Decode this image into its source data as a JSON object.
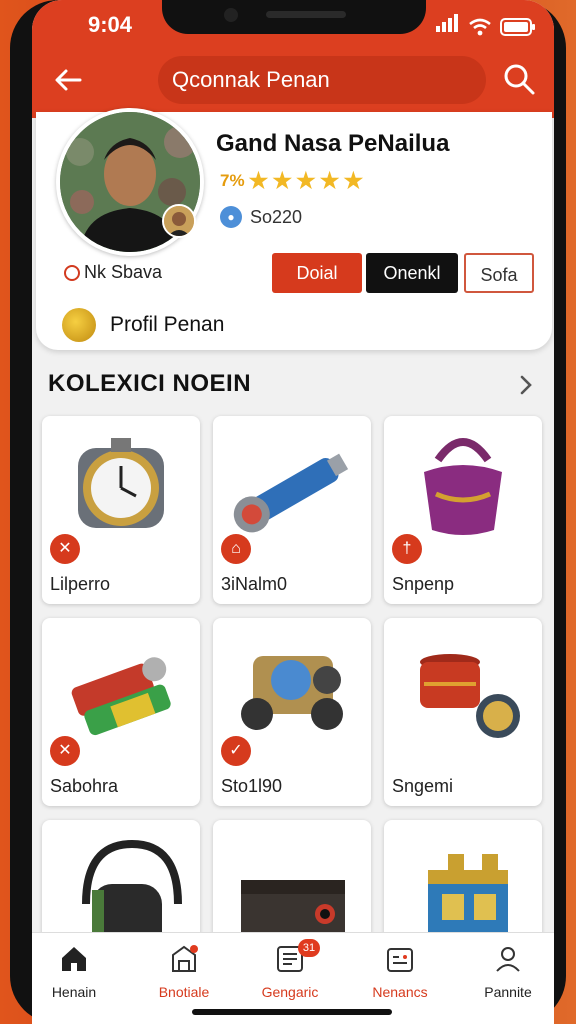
{
  "status_bar": {
    "time": "9:04"
  },
  "header": {
    "search_text": "Qconnak Penan"
  },
  "profile": {
    "name": "Gand Nasa PeNailua",
    "rating_text": "7%",
    "stat_value": "So220",
    "sub_label": "Nk Sbava",
    "buttons": {
      "primary": "Doial",
      "secondary": "Onenkl",
      "outline": "Sofa"
    },
    "profile_link": "Profil Penan"
  },
  "collection": {
    "title": "KOLEXICI NOEIN",
    "items": [
      {
        "label": "Lilperro",
        "badge": "✕"
      },
      {
        "label": "3iNalm0",
        "badge": "⌂"
      },
      {
        "label": "Snpenp",
        "badge": "†"
      },
      {
        "label": "Sabohra",
        "badge": "✕"
      },
      {
        "label": "Sto1l90",
        "badge": "✓"
      },
      {
        "label": "Sngemi",
        "badge": ""
      },
      {
        "label": "",
        "badge": ""
      },
      {
        "label": "",
        "badge": ""
      },
      {
        "label": "",
        "badge": ""
      }
    ]
  },
  "bottom_nav": {
    "items": [
      {
        "label": "Henain",
        "icon": "home-icon",
        "color": "#222222"
      },
      {
        "label": "Bnotiale",
        "icon": "shop-icon",
        "color": "#d63a1d"
      },
      {
        "label": "Gengaric",
        "icon": "list-icon",
        "color": "#d63a1d",
        "badge": "31"
      },
      {
        "label": "Nenancs",
        "icon": "calendar-icon",
        "color": "#d63a1d"
      },
      {
        "label": "Pannite",
        "icon": "user-icon",
        "color": "#222222"
      }
    ]
  },
  "colors": {
    "accent": "#dc3f20",
    "dark": "#111111"
  }
}
